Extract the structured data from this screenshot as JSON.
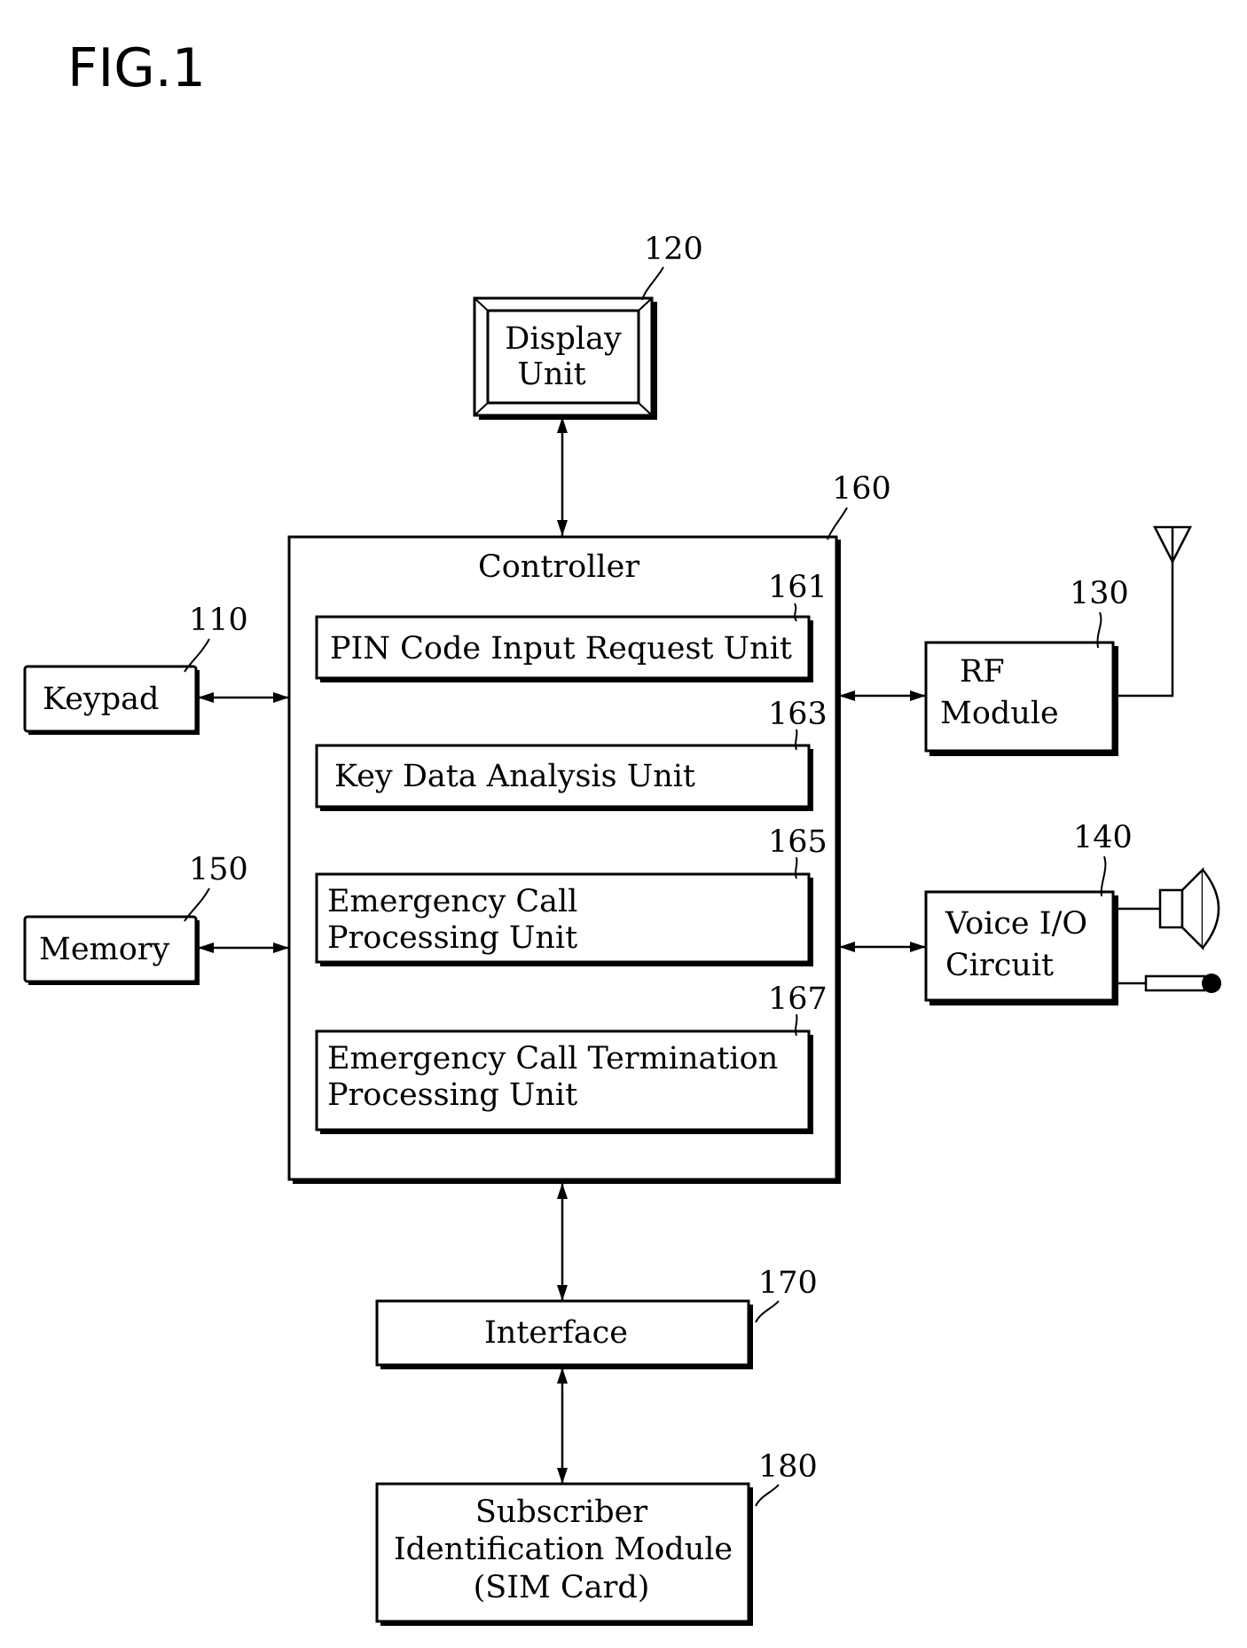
{
  "figure": {
    "title": "FIG.1"
  },
  "blocks": {
    "display": {
      "lines": [
        "Display",
        "Unit"
      ],
      "ref": "120"
    },
    "controller": {
      "title": "Controller",
      "ref": "160"
    },
    "pin_unit": {
      "lines": [
        "PIN Code Input Request Unit"
      ],
      "ref": "161"
    },
    "key_data": {
      "lines": [
        "Key Data Analysis Unit"
      ],
      "ref": "163"
    },
    "ecpu": {
      "lines": [
        "Emergency Call",
        "Processing Unit"
      ],
      "ref": "165"
    },
    "ectpu": {
      "lines": [
        "Emergency Call Termination",
        "Processing Unit"
      ],
      "ref": "167"
    },
    "keypad": {
      "lines": [
        "Keypad"
      ],
      "ref": "110"
    },
    "memory": {
      "lines": [
        "Memory"
      ],
      "ref": "150"
    },
    "rf": {
      "lines": [
        "RF",
        "Module"
      ],
      "ref": "130"
    },
    "voice": {
      "lines": [
        "Voice I/O",
        "Circuit"
      ],
      "ref": "140"
    },
    "interface": {
      "lines": [
        "Interface"
      ],
      "ref": "170"
    },
    "sim": {
      "lines": [
        "Subscriber",
        "Identification Module",
        "(SIM Card)"
      ],
      "ref": "180"
    }
  },
  "icons": {
    "antenna": "antenna-icon",
    "speaker": "speaker-icon",
    "microphone": "microphone-icon"
  },
  "connections": [
    {
      "from": "display",
      "to": "controller",
      "bidirectional": true
    },
    {
      "from": "keypad",
      "to": "controller",
      "bidirectional": true
    },
    {
      "from": "memory",
      "to": "controller",
      "bidirectional": true
    },
    {
      "from": "controller",
      "to": "rf",
      "bidirectional": true
    },
    {
      "from": "controller",
      "to": "voice",
      "bidirectional": true
    },
    {
      "from": "controller",
      "to": "interface",
      "bidirectional": true
    },
    {
      "from": "interface",
      "to": "sim",
      "bidirectional": true
    },
    {
      "from": "rf",
      "to": "antenna",
      "bidirectional": false
    },
    {
      "from": "voice",
      "to": "speaker",
      "bidirectional": false
    },
    {
      "from": "voice",
      "to": "microphone",
      "bidirectional": false
    }
  ]
}
